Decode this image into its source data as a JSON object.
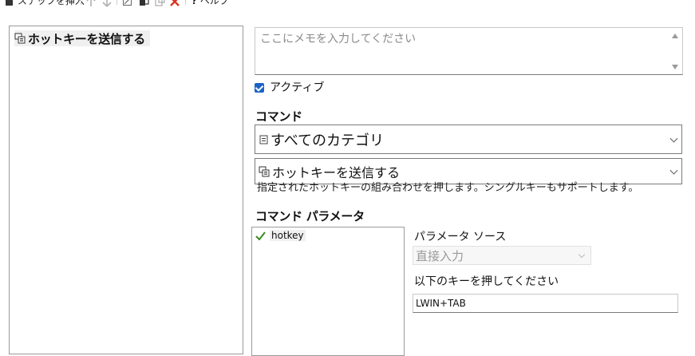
{
  "toolbar": {
    "insert_step_label": "ステップを挿入",
    "help_label": "ヘルプ",
    "help_glyph": "?"
  },
  "steps": {
    "items": [
      {
        "label": "ホットキーを送信する",
        "icon": "hotkey-icon"
      }
    ]
  },
  "memo": {
    "placeholder": "ここにメモを入力してください"
  },
  "active": {
    "label": "アクティブ",
    "checked": true
  },
  "command": {
    "section_label": "コマンド",
    "category_value": "すべてのカテゴリ",
    "command_value": "ホットキーを送信する",
    "description": "指定されたホットキーの組み合わせを押します。シングルキーもサポートします。"
  },
  "params": {
    "section_label": "コマンド パラメータ",
    "items": [
      {
        "name": "hotkey",
        "status": "check-icon"
      }
    ],
    "source_label": "パラメータ ソース",
    "source_value": "直接入力",
    "prompt_label": "以下のキーを押してください",
    "key_value": "LWIN+TAB"
  },
  "colors": {
    "accent": "#1a63c6",
    "check": "#3a8a24",
    "delete": "#d8351e"
  }
}
